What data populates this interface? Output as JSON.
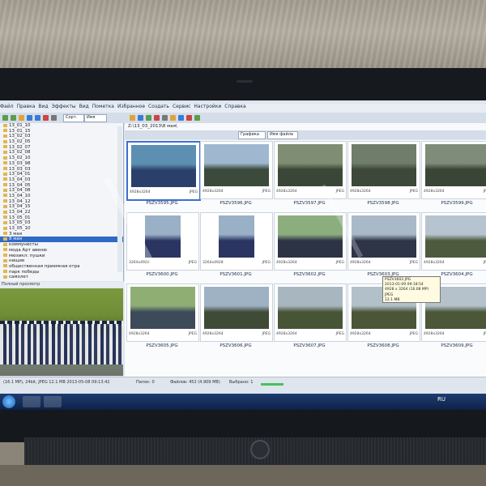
{
  "menu": [
    "Файл",
    "Правка",
    "Вид",
    "Эффекты",
    "Вид",
    "Пометка",
    "Избранное",
    "Создать",
    "Сервис",
    "Настройки",
    "Справка"
  ],
  "toolbar": {
    "sort_label": "Сорт.",
    "sort_value": "Имя",
    "view_value": "Графика",
    "filter_value": "Имя файла"
  },
  "path": "Z:\\13_03_2013\\8 мая\\",
  "folders": [
    {
      "label": "13_01_10"
    },
    {
      "label": "13_01_15"
    },
    {
      "label": "13_02_03"
    },
    {
      "label": "13_02_05"
    },
    {
      "label": "13_02_07"
    },
    {
      "label": "13_02_08"
    },
    {
      "label": "13_02_10"
    },
    {
      "label": "13_03_98"
    },
    {
      "label": "13_03_03"
    },
    {
      "label": "13_04_01"
    },
    {
      "label": "13_04_03"
    },
    {
      "label": "13_04_05"
    },
    {
      "label": "13_04_08"
    },
    {
      "label": "13_04_10"
    },
    {
      "label": "13_04_12"
    },
    {
      "label": "13_04_15"
    },
    {
      "label": "13_04_22"
    },
    {
      "label": "13_05_01"
    },
    {
      "label": "13_05_03"
    },
    {
      "label": "13_05_10"
    },
    {
      "label": "3 мая"
    },
    {
      "label": "8 мая"
    },
    {
      "label": "коммунисты"
    },
    {
      "label": "мода Арт авеню"
    },
    {
      "label": "мюзикл: пушки"
    },
    {
      "label": "нищие"
    },
    {
      "label": "общественная приемная отра"
    },
    {
      "label": "парк победы"
    },
    {
      "label": "самолет"
    }
  ],
  "preview_label": "Полный просмотр",
  "thumbnails": [
    {
      "name": "PSZV3595.JPG",
      "dims": "4928x3264",
      "fmt": "JPEG"
    },
    {
      "name": "PSZV3596.JPG",
      "dims": "4928x3264",
      "fmt": "JPEG"
    },
    {
      "name": "PSZV3597.JPG",
      "dims": "4928x3264",
      "fmt": "JPEG"
    },
    {
      "name": "PSZV3598.JPG",
      "dims": "4928x3264",
      "fmt": "JPEG"
    },
    {
      "name": "PSZV3599.JPG",
      "dims": "4928x3264",
      "fmt": "JPEG"
    },
    {
      "name": "PSZV3600.JPG",
      "dims": "3264x4928",
      "fmt": "JPEG"
    },
    {
      "name": "PSZV3601.JPG",
      "dims": "3264x4928",
      "fmt": "JPEG"
    },
    {
      "name": "PSZV3602.JPG",
      "dims": "4928x3264",
      "fmt": "JPEG"
    },
    {
      "name": "PSZV3603.JPG",
      "dims": "4928x3264",
      "fmt": "JPEG"
    },
    {
      "name": "PSZV3604.JPG",
      "dims": "4928x3264",
      "fmt": "JPEG"
    },
    {
      "name": "PSZV3605.JPG",
      "dims": "4928x3264",
      "fmt": "JPEG"
    },
    {
      "name": "PSZV3606.JPG",
      "dims": "4928x3264",
      "fmt": "JPEG"
    },
    {
      "name": "PSZV3607.JPG",
      "dims": "4928x3264",
      "fmt": "JPEG"
    },
    {
      "name": "PSZV3608.JPG",
      "dims": "4928x3264",
      "fmt": "JPEG"
    },
    {
      "name": "PSZV3609.JPG",
      "dims": "4928x3264",
      "fmt": "JPEG"
    }
  ],
  "tooltip": [
    "PSZV3602.JPG",
    "2013-01-09 09:18:54",
    "4928 x 3264 (16.08 MP)  JPEG",
    "12.1 MB"
  ],
  "status": {
    "left": "(16.1 MP), 24bit, JPEG  12.1 MB  2013-05-08 09:13:42",
    "files": "Папок: 0",
    "selected": "Файлов: 452 (4.909 MB)",
    "chosen": "Выбрано: 1"
  },
  "tray": {
    "lang": "RU"
  },
  "colors": {
    "selection": "#316ac5",
    "taskbar": "#1e3c6e"
  }
}
